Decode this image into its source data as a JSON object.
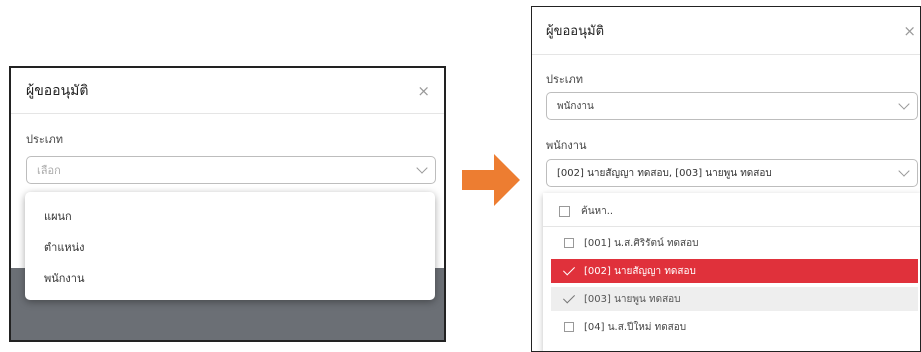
{
  "left_modal": {
    "title": "ผู้ขออนุมัติ",
    "close_label": "×",
    "type_label": "ประเภท",
    "type_placeholder": "เลือก",
    "dropdown_options": [
      "แผนก",
      "ตำแหน่ง",
      "พนักงาน"
    ]
  },
  "right_modal": {
    "title": "ผู้ขออนุมัติ",
    "close_label": "×",
    "type_label": "ประเภท",
    "type_value": "พนักงาน",
    "employee_label": "พนักงาน",
    "employee_value": "[002] นายสัญญา ทดสอบ, [003] นายพูน ทดสอบ",
    "search_placeholder": "ค้นหา..",
    "options": [
      {
        "label": "[001] น.ส.ศิริรัตน์ ทดสอบ",
        "state": "unchecked"
      },
      {
        "label": "[002] นายสัญญา ทดสอบ",
        "state": "selected-highlight"
      },
      {
        "label": "[003] นายพูน ทดสอบ",
        "state": "selected"
      },
      {
        "label": "[04] น.ส.ปีใหม่ ทดสอบ",
        "state": "unchecked"
      }
    ]
  },
  "colors": {
    "overlay": "#6b6f75",
    "highlight_red": "#e0313b",
    "selected_gray": "#eeeeee",
    "arrow_orange": "#ed7d31"
  }
}
